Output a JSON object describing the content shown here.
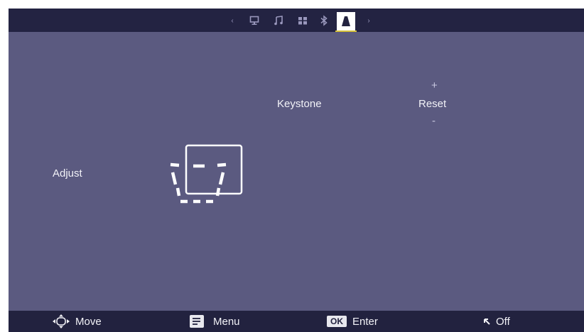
{
  "nav": {
    "tabs": [
      {
        "icon": "monitor-icon",
        "active": false
      },
      {
        "icon": "music-note-icon",
        "active": false
      },
      {
        "icon": "apps-grid-icon",
        "active": false
      },
      {
        "icon": "bluetooth-icon",
        "active": false
      },
      {
        "icon": "keystone-cone-icon",
        "active": true
      }
    ],
    "active_color": "#d6c23a"
  },
  "settings": {
    "keystone_label": "Keystone",
    "reset_label": "Reset",
    "plus_symbol": "+",
    "minus_symbol": "-",
    "adjust_label": "Adjust"
  },
  "footer": {
    "move_label": "Move",
    "menu_label": "Menu",
    "ok_key": "OK",
    "enter_label": "Enter",
    "off_label": "Off"
  },
  "colors": {
    "background": "#5b5a80",
    "bars": "#22223f",
    "text": "#f2f2f7"
  }
}
